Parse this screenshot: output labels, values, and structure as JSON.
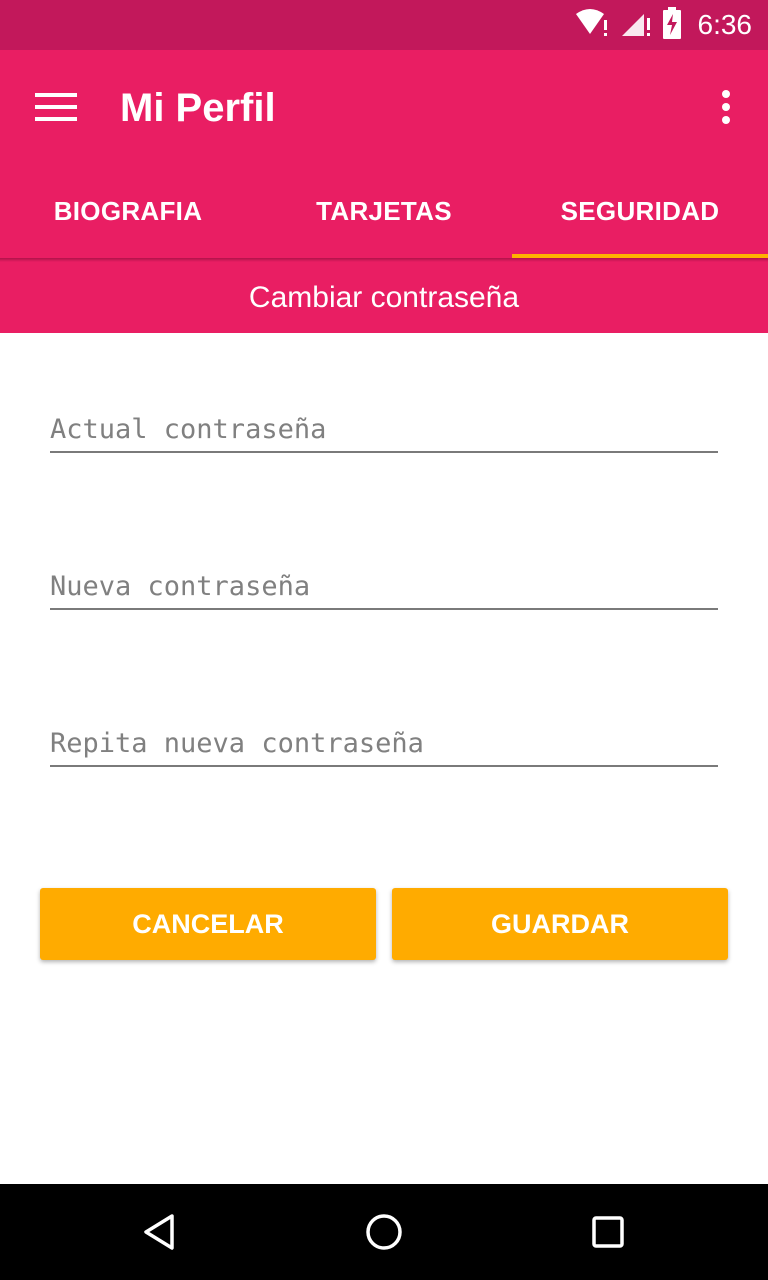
{
  "status_bar": {
    "time": "6:36",
    "icons": [
      "wifi-alert-icon",
      "signal-alert-icon",
      "battery-charging-icon"
    ]
  },
  "app_bar": {
    "title": "Mi Perfil",
    "menu_icon": "hamburger-menu-icon",
    "overflow_icon": "more-vert-icon"
  },
  "tabs": [
    {
      "label": "BIOGRAFIA",
      "selected": false
    },
    {
      "label": "TARJETAS",
      "selected": false
    },
    {
      "label": "SEGURIDAD",
      "selected": true
    }
  ],
  "section": {
    "title": "Cambiar contraseña"
  },
  "form": {
    "current_password_placeholder": "Actual contraseña",
    "new_password_placeholder": "Nueva contraseña",
    "repeat_password_placeholder": "Repita nueva contraseña"
  },
  "buttons": {
    "cancel_label": "CANCELAR",
    "save_label": "GUARDAR"
  },
  "colors": {
    "primary": "#e91e63",
    "primary_dark": "#c2185b",
    "accent": "#ffab00"
  },
  "nav_bar": {
    "icons": [
      "back-icon",
      "home-icon",
      "recents-icon"
    ]
  }
}
